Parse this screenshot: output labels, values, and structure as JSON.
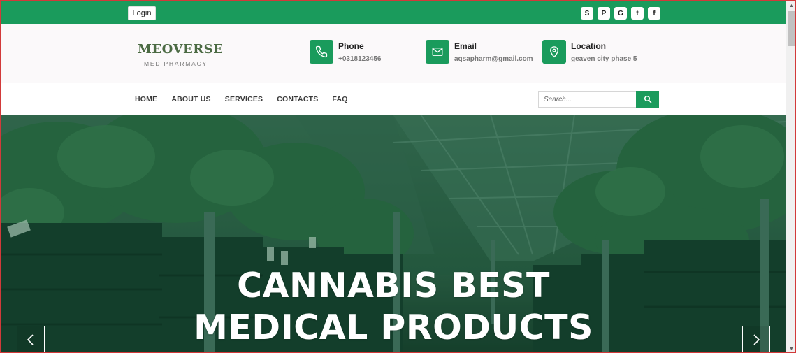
{
  "topbar": {
    "login_label": "Login",
    "socials": [
      {
        "icon": "skype-icon",
        "glyph": "S"
      },
      {
        "icon": "pinterest-icon",
        "glyph": "P"
      },
      {
        "icon": "google-icon",
        "glyph": "G"
      },
      {
        "icon": "twitter-icon",
        "glyph": "t"
      },
      {
        "icon": "facebook-icon",
        "glyph": "f"
      }
    ]
  },
  "brand": {
    "name": "MEOVERSE",
    "tagline": "MED PHARMACY"
  },
  "contacts": [
    {
      "title": "Phone",
      "value": "+0318123456",
      "icon": "phone-icon"
    },
    {
      "title": "Email",
      "value": "aqsapharm@gmail.com",
      "icon": "email-icon"
    },
    {
      "title": "Location",
      "value": "geaven city phase 5",
      "icon": "location-icon"
    }
  ],
  "nav": {
    "items": [
      "HOME",
      "ABOUT US",
      "SERVICES",
      "CONTACTS",
      "FAQ"
    ]
  },
  "search": {
    "placeholder": "Search..."
  },
  "hero": {
    "title_line1": "CANNABIS BEST",
    "title_line2": "MEDICAL PRODUCTS"
  },
  "colors": {
    "accent": "#1a9b5c",
    "hero_overlay": "#1f4a33"
  }
}
